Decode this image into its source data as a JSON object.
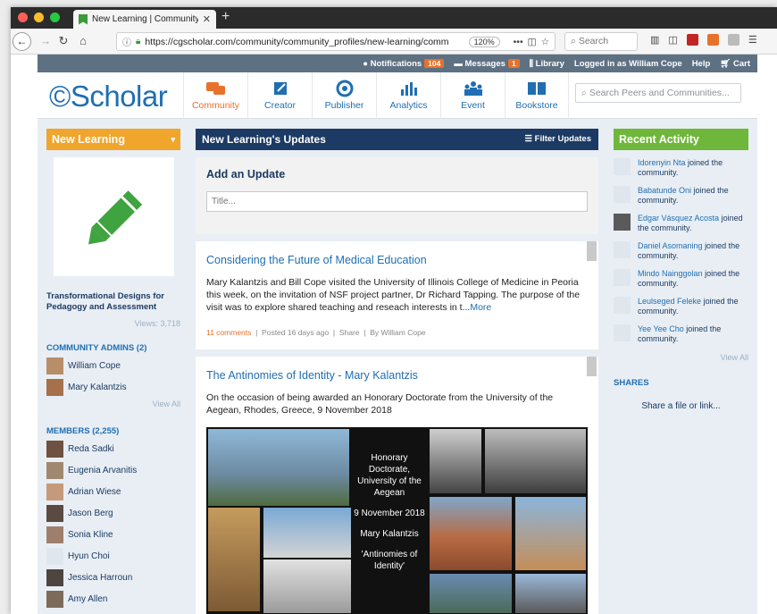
{
  "browser": {
    "tab_title": "New Learning | Community | Sc",
    "url": "https://cgscholar.com/community/community_profiles/new-learning/comm",
    "zoom": "120%",
    "search_placeholder": "Search"
  },
  "topbar": {
    "notifications_label": "Notifications",
    "notifications_count": "104",
    "messages_label": "Messages",
    "messages_count": "1",
    "library_label": "Library",
    "logged_in": "Logged in as William Cope",
    "help_label": "Help",
    "cart_label": "Cart"
  },
  "header": {
    "logo": "Scholar",
    "nav": [
      {
        "label": "Community",
        "icon": "community-icon"
      },
      {
        "label": "Creator",
        "icon": "creator-icon"
      },
      {
        "label": "Publisher",
        "icon": "publisher-icon"
      },
      {
        "label": "Analytics",
        "icon": "analytics-icon"
      },
      {
        "label": "Event",
        "icon": "event-icon"
      },
      {
        "label": "Bookstore",
        "icon": "bookstore-icon"
      }
    ],
    "search_placeholder": "Search Peers and Communities..."
  },
  "left": {
    "community_name": "New Learning",
    "group_title": "Transformational Designs for Pedagogy and Assessment",
    "views": "Views: 3,718",
    "admins_heading": "COMMUNITY ADMINS (2)",
    "admins": [
      "William Cope",
      "Mary Kalantzis"
    ],
    "admins_view_all": "View All",
    "members_heading": "MEMBERS (2,255)",
    "members": [
      "Reda Sadki",
      "Eugenia Arvanitis",
      "Adrian Wiese",
      "Jason Berg",
      "Sonia Kline",
      "Hyun Choi",
      "Jessica Harroun",
      "Amy Allen"
    ]
  },
  "center": {
    "heading": "New Learning's Updates",
    "filter_label": "Filter Updates",
    "add_update_heading": "Add an Update",
    "title_placeholder": "Title...",
    "posts": [
      {
        "title": "Considering the Future of Medical Education",
        "body": "Mary Kalantzis and Bill Cope visited the University of Illinois College of Medicine in Peoria this week, on the invitation of NSF project partner, Dr Richard Tapping. The purpose of the visit was to explore shared teaching and reseach interests in t...",
        "more": "More",
        "comments": "11 comments",
        "posted": "Posted 16 days ago",
        "share": "Share",
        "by": "By William Cope"
      },
      {
        "title": "The Antinomies of Identity - Mary Kalantzis",
        "body": "On the occasion of being awarded an Honorary Doctorate from the University of the Aegean, Rhodes, Greece, 9 November 2018",
        "collage_lines": [
          "Honorary Doctorate, University of the Aegean",
          "9 November 2018",
          "Mary Kalantzis",
          "'Antinomies of Identity'"
        ]
      }
    ]
  },
  "right": {
    "heading": "Recent Activity",
    "activity": [
      {
        "who": "Idorenyin Nta",
        "what": "joined the community."
      },
      {
        "who": "Babatunde Oni",
        "what": "joined the community."
      },
      {
        "who": "Edgar Vásquez Acosta",
        "what": "joined the community."
      },
      {
        "who": "Daniel Asomaning",
        "what": "joined the community."
      },
      {
        "who": "Mindo Nainggolan",
        "what": "joined the community."
      },
      {
        "who": "Leulseged Feleke",
        "what": "joined the community."
      },
      {
        "who": "Yee Yee Cho",
        "what": "joined the community."
      }
    ],
    "view_all": "View All",
    "shares_heading": "SHARES",
    "share_link": "Share a file or link..."
  },
  "colors": {
    "accent_blue": "#1f6fb2",
    "navy": "#1c3a63",
    "orange": "#f0a52c",
    "green": "#6fb73a",
    "topstrip": "#5e7183"
  }
}
